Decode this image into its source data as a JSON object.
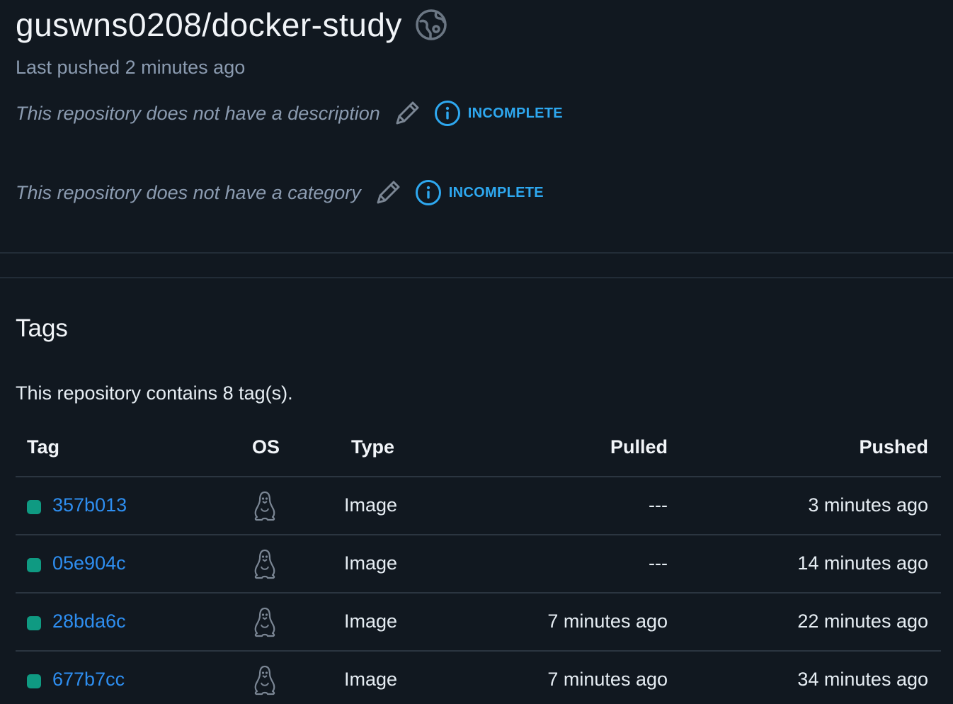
{
  "repo": {
    "title": "guswns0208/docker-study",
    "visibility_icon": "globe-icon",
    "last_pushed": "Last pushed 2 minutes ago"
  },
  "description": {
    "text": "This repository does not have a description",
    "badge": "INCOMPLETE"
  },
  "category": {
    "text": "This repository does not have a category",
    "badge": "INCOMPLETE"
  },
  "tags_section": {
    "title": "Tags",
    "count_text": "This repository contains 8 tag(s).",
    "columns": {
      "tag": "Tag",
      "os": "OS",
      "type": "Type",
      "pulled": "Pulled",
      "pushed": "Pushed"
    },
    "rows": [
      {
        "tag": "357b013",
        "os": "linux-icon",
        "type": "Image",
        "pulled": "---",
        "pushed": "3 minutes ago"
      },
      {
        "tag": "05e904c",
        "os": "linux-icon",
        "type": "Image",
        "pulled": "---",
        "pushed": "14 minutes ago"
      },
      {
        "tag": "28bda6c",
        "os": "linux-icon",
        "type": "Image",
        "pulled": "7 minutes ago",
        "pushed": "22 minutes ago"
      },
      {
        "tag": "677b7cc",
        "os": "linux-icon",
        "type": "Image",
        "pulled": "7 minutes ago",
        "pushed": "34 minutes ago"
      }
    ]
  },
  "colors": {
    "background": "#111820",
    "accent_link": "#2e8ef0",
    "badge": "#2ea8f0",
    "tag_status": "#0f9a82",
    "muted_text": "#8b9bb0"
  }
}
